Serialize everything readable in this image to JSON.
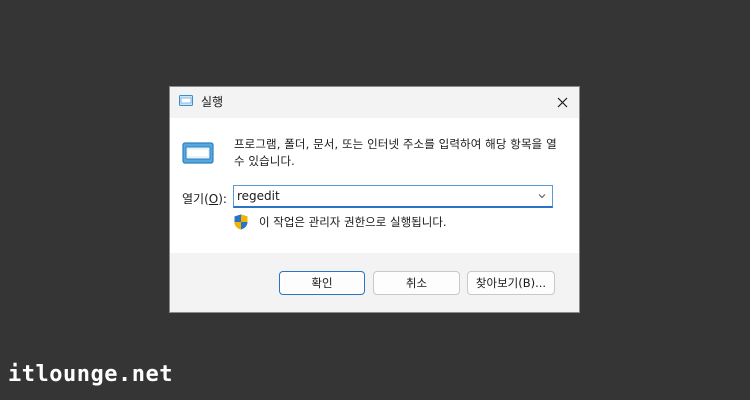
{
  "dialog": {
    "title": "실행",
    "description": "프로그램, 폴더, 문서, 또는 인터넷 주소를 입력하여 해당 항목을 열 수 있습니다.",
    "open_label_prefix": "열기(",
    "open_label_mnemonic": "O",
    "open_label_suffix": "):",
    "input_value": "regedit",
    "admin_note": "이 작업은 관리자 권한으로 실행됩니다.",
    "buttons": {
      "ok": "확인",
      "cancel": "취소",
      "browse": "찾아보기(B)..."
    }
  },
  "icons": {
    "title": "run-window-icon",
    "close": "close-icon",
    "main": "run-window-icon",
    "dropdown": "chevron-down-icon",
    "admin": "uac-shield-icon"
  },
  "colors": {
    "desktop_bg": "#353535",
    "accent": "#2a73c5"
  },
  "watermark": "itlounge.net"
}
